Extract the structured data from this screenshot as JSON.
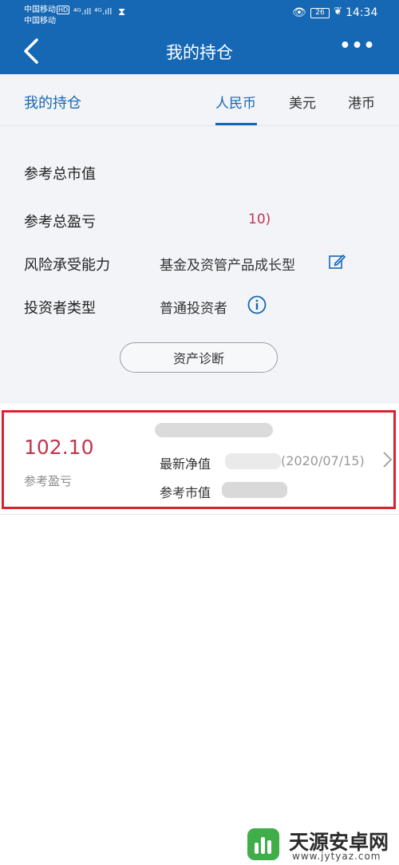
{
  "status_bar": {
    "carrier_1": "中国移动",
    "carrier_1_badge": "HD",
    "carrier_2": "中国移动",
    "signal_1": "⁴ᴳ.ıll",
    "signal_2": "⁴ᴳ.ıll",
    "battery": "26",
    "time": "14:34"
  },
  "nav": {
    "title": "我的持仓"
  },
  "tabs": {
    "page_label": "我的持仓",
    "items": [
      "人民币",
      "美元",
      "港币"
    ],
    "active": "人民币"
  },
  "summary": {
    "total_market_value_label": "参考总市值",
    "total_pl_label": "参考总盈亏",
    "total_pl_value": "10)",
    "risk_label": "风险承受能力",
    "risk_value": "基金及资管产品成长型",
    "investor_type_label": "投资者类型",
    "investor_type_value": "普通投资者",
    "diagnose_button": "资产诊断"
  },
  "holding": {
    "pl_value": "102.10",
    "pl_label": "参考盈亏",
    "nav_label": "最新净值",
    "nav_date": "(2020/07/15)",
    "market_value_label": "参考市值"
  },
  "footer": {
    "name": "天源安卓网",
    "url": "www.jytyaz.com"
  },
  "colors": {
    "primary": "#1668b4",
    "accent_red": "#c0374e",
    "highlight_border": "#d8232f"
  }
}
